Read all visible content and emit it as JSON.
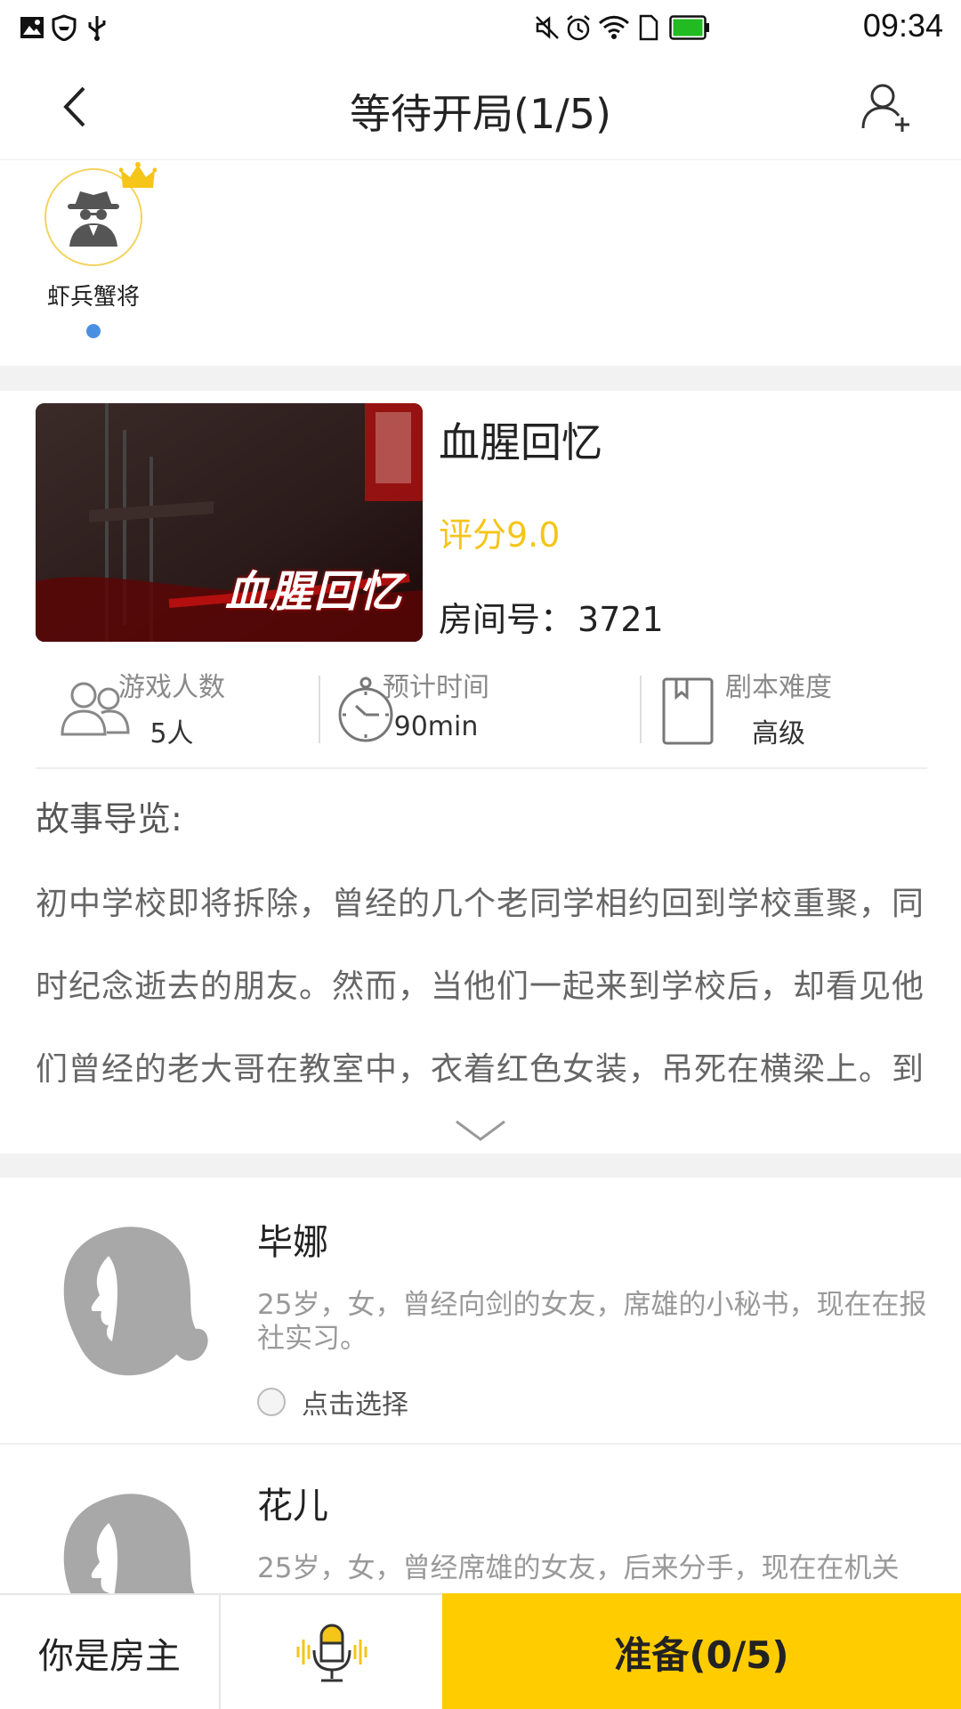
{
  "status_bar": {
    "time": "09:34",
    "icons": [
      "image-icon",
      "shield-icon",
      "usb-icon",
      "mute-icon",
      "alarm-icon",
      "wifi-icon",
      "sim-icon",
      "battery-icon"
    ],
    "battery_color": "#22bb22"
  },
  "header": {
    "title": "等待开局(1/5)",
    "back_icon": "chevron-left-icon",
    "add_icon": "add-user-icon"
  },
  "players": [
    {
      "name": "虾兵蟹将",
      "is_host": true,
      "online_color": "#4a90e2"
    }
  ],
  "script": {
    "cover_text": "血腥回忆",
    "title": "血腥回忆",
    "score": "评分9.0",
    "room_label": "房间号：",
    "room_number": "3721",
    "stats": [
      {
        "icon": "people-icon",
        "label": "游戏人数",
        "value": "5人"
      },
      {
        "icon": "stopwatch-icon",
        "label": "预计时间",
        "value": "90min"
      },
      {
        "icon": "book-icon",
        "label": "剧本难度",
        "value": "高级"
      }
    ],
    "story_heading": "故事导览:",
    "story_text": "初中学校即将拆除，曾经的几个老同学相约回到学校重聚，同时纪念逝去的朋友。然而，当他们一起来到学校后，却看见他们曾经的老大哥在教室中，衣着红色女装，吊死在横梁上。到",
    "expand_icon": "chevron-down-icon"
  },
  "roles": [
    {
      "name": "毕娜",
      "description": "25岁，女，曾经向剑的女友，席雄的小秘书，现在在报社实习。",
      "pick_label": "点击选择"
    },
    {
      "name": "花儿",
      "description": "25岁，女，曾经席雄的女友，后来分手，现在在机关",
      "pick_label": ""
    }
  ],
  "bottom_bar": {
    "host_label": "你是房主",
    "mic_icon": "microphone-icon",
    "ready_label": "准备(0/5)",
    "accent_color": "#ffcc00"
  }
}
